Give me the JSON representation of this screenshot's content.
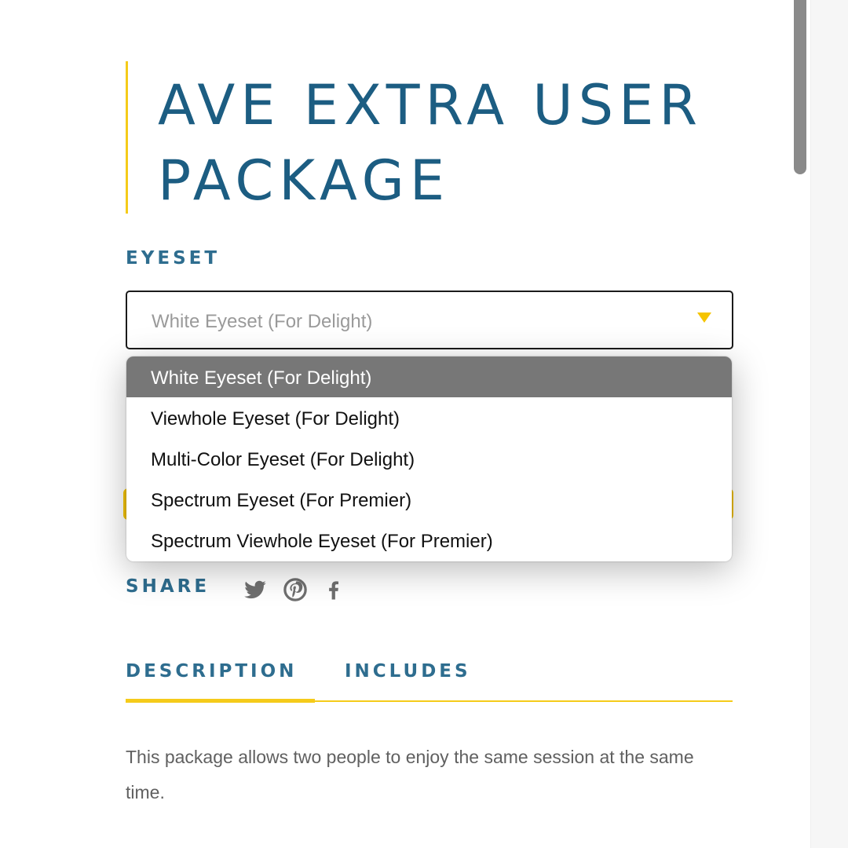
{
  "product": {
    "title": "AVE EXTRA USER PACKAGE"
  },
  "eyeset": {
    "label": "EYESET",
    "selected_value": "White Eyeset (For Delight)",
    "options": [
      {
        "label": "White Eyeset (For Delight)",
        "selected": true
      },
      {
        "label": "Viewhole Eyeset (For Delight)",
        "selected": false
      },
      {
        "label": "Multi-Color Eyeset (For Delight)",
        "selected": false
      },
      {
        "label": "Spectrum Eyeset (For Premier)",
        "selected": false
      },
      {
        "label": "Spectrum Viewhole Eyeset (For Premier)",
        "selected": false
      }
    ]
  },
  "share": {
    "label": "SHARE",
    "icons": [
      "twitter-icon",
      "pinterest-icon",
      "facebook-icon"
    ]
  },
  "tabs": [
    {
      "label": "DESCRIPTION",
      "active": true
    },
    {
      "label": "INCLUDES",
      "active": false
    }
  ],
  "description": {
    "text": "This package allows two people to enjoy the same session at the same time."
  },
  "colors": {
    "accent_yellow": "#f5cb1a",
    "heading_blue": "#1c5d82",
    "label_blue": "#2e6d8f",
    "selected_option_bg": "#777777"
  }
}
